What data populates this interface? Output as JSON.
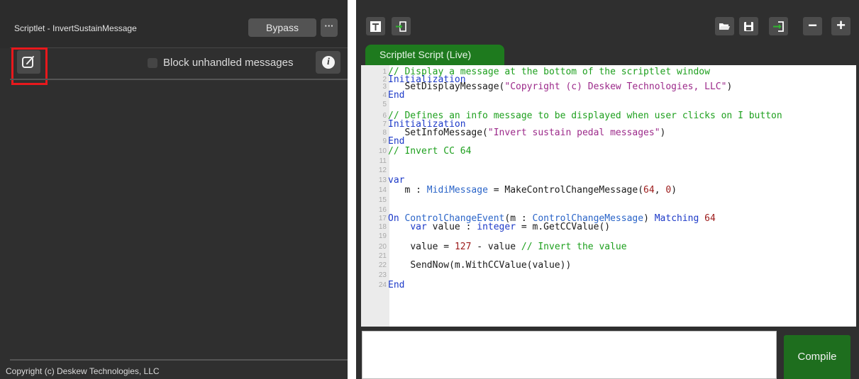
{
  "scriptlet_panel": {
    "title": "Scriptlet - InvertSustainMessage",
    "bypass_label": "Bypass",
    "more_label": "···",
    "block_unhandled_label": "Block unhandled messages",
    "block_unhandled_checked": false,
    "info_label": "i",
    "status_message": "Copyright (c) Deskew Technologies, LLC"
  },
  "editor_window": {
    "tab_label": "Scriptlet Script (Live)",
    "zoom_out_label": "−",
    "zoom_in_label": "+",
    "compile_label": "Compile",
    "output_text": "",
    "code_lines": [
      {
        "num": "1",
        "indent": "",
        "tokens": [
          {
            "t": "// Display a message at the bottom of the scriptlet window",
            "c": "cm"
          }
        ]
      },
      {
        "num": "2",
        "indent": "",
        "tokens": [
          {
            "t": "Initialization",
            "c": "kw"
          }
        ]
      },
      {
        "num": "3",
        "indent": "   ",
        "tokens": [
          {
            "t": "SetDisplayMessage(",
            "c": "tx"
          },
          {
            "t": "\"Copyright (c) Deskew Technologies, LLC\"",
            "c": "st"
          },
          {
            "t": ")",
            "c": "tx"
          }
        ]
      },
      {
        "num": "4",
        "indent": "",
        "tokens": [
          {
            "t": "End",
            "c": "kw"
          }
        ]
      },
      {
        "num": "5",
        "indent": "",
        "tokens": []
      },
      {
        "num": "6",
        "indent": "",
        "tokens": [
          {
            "t": "// Defines an info message to be displayed when user clicks on I button",
            "c": "cm"
          }
        ]
      },
      {
        "num": "7",
        "indent": "",
        "tokens": [
          {
            "t": "Initialization",
            "c": "kw"
          }
        ]
      },
      {
        "num": "8",
        "indent": "   ",
        "tokens": [
          {
            "t": "SetInfoMessage(",
            "c": "tx"
          },
          {
            "t": "\"Invert sustain pedal messages\"",
            "c": "st"
          },
          {
            "t": ")",
            "c": "tx"
          }
        ]
      },
      {
        "num": "9",
        "indent": "",
        "tokens": [
          {
            "t": "End",
            "c": "kw"
          }
        ]
      },
      {
        "num": "10",
        "indent": "",
        "tokens": [
          {
            "t": "// Invert CC 64",
            "c": "cm"
          }
        ]
      },
      {
        "num": "11",
        "indent": "",
        "tokens": []
      },
      {
        "num": "12",
        "indent": "",
        "tokens": []
      },
      {
        "num": "13",
        "indent": "",
        "tokens": [
          {
            "t": "var",
            "c": "kw"
          }
        ]
      },
      {
        "num": "14",
        "indent": "   ",
        "tokens": [
          {
            "t": "m : ",
            "c": "tx"
          },
          {
            "t": "MidiMessage",
            "c": "ty"
          },
          {
            "t": " = MakeControlChangeMessage(",
            "c": "tx"
          },
          {
            "t": "64",
            "c": "nu"
          },
          {
            "t": ", ",
            "c": "tx"
          },
          {
            "t": "0",
            "c": "nu"
          },
          {
            "t": ")",
            "c": "tx"
          }
        ]
      },
      {
        "num": "15",
        "indent": "",
        "tokens": []
      },
      {
        "num": "16",
        "indent": "",
        "tokens": []
      },
      {
        "num": "17",
        "indent": "",
        "tokens": [
          {
            "t": "On ",
            "c": "kw"
          },
          {
            "t": "ControlChangeEvent",
            "c": "ty"
          },
          {
            "t": "(m : ",
            "c": "tx"
          },
          {
            "t": "ControlChangeMessage",
            "c": "ty"
          },
          {
            "t": ") ",
            "c": "tx"
          },
          {
            "t": "Matching ",
            "c": "kw"
          },
          {
            "t": "64",
            "c": "nu"
          }
        ]
      },
      {
        "num": "18",
        "indent": "    ",
        "tokens": [
          {
            "t": "var",
            "c": "kw"
          },
          {
            "t": " value : ",
            "c": "tx"
          },
          {
            "t": "integer",
            "c": "kw"
          },
          {
            "t": " = m.GetCCValue()",
            "c": "tx"
          }
        ]
      },
      {
        "num": "19",
        "indent": "",
        "tokens": []
      },
      {
        "num": "20",
        "indent": "    ",
        "tokens": [
          {
            "t": "value = ",
            "c": "tx"
          },
          {
            "t": "127",
            "c": "nu"
          },
          {
            "t": " - value ",
            "c": "tx"
          },
          {
            "t": "// Invert the value",
            "c": "cm"
          }
        ]
      },
      {
        "num": "21",
        "indent": "",
        "tokens": []
      },
      {
        "num": "22",
        "indent": "    ",
        "tokens": [
          {
            "t": "SendNow(m.WithCCValue(value))",
            "c": "tx"
          }
        ]
      },
      {
        "num": "23",
        "indent": "",
        "tokens": []
      },
      {
        "num": "24",
        "indent": "",
        "tokens": [
          {
            "t": "End",
            "c": "kw"
          }
        ]
      }
    ]
  }
}
